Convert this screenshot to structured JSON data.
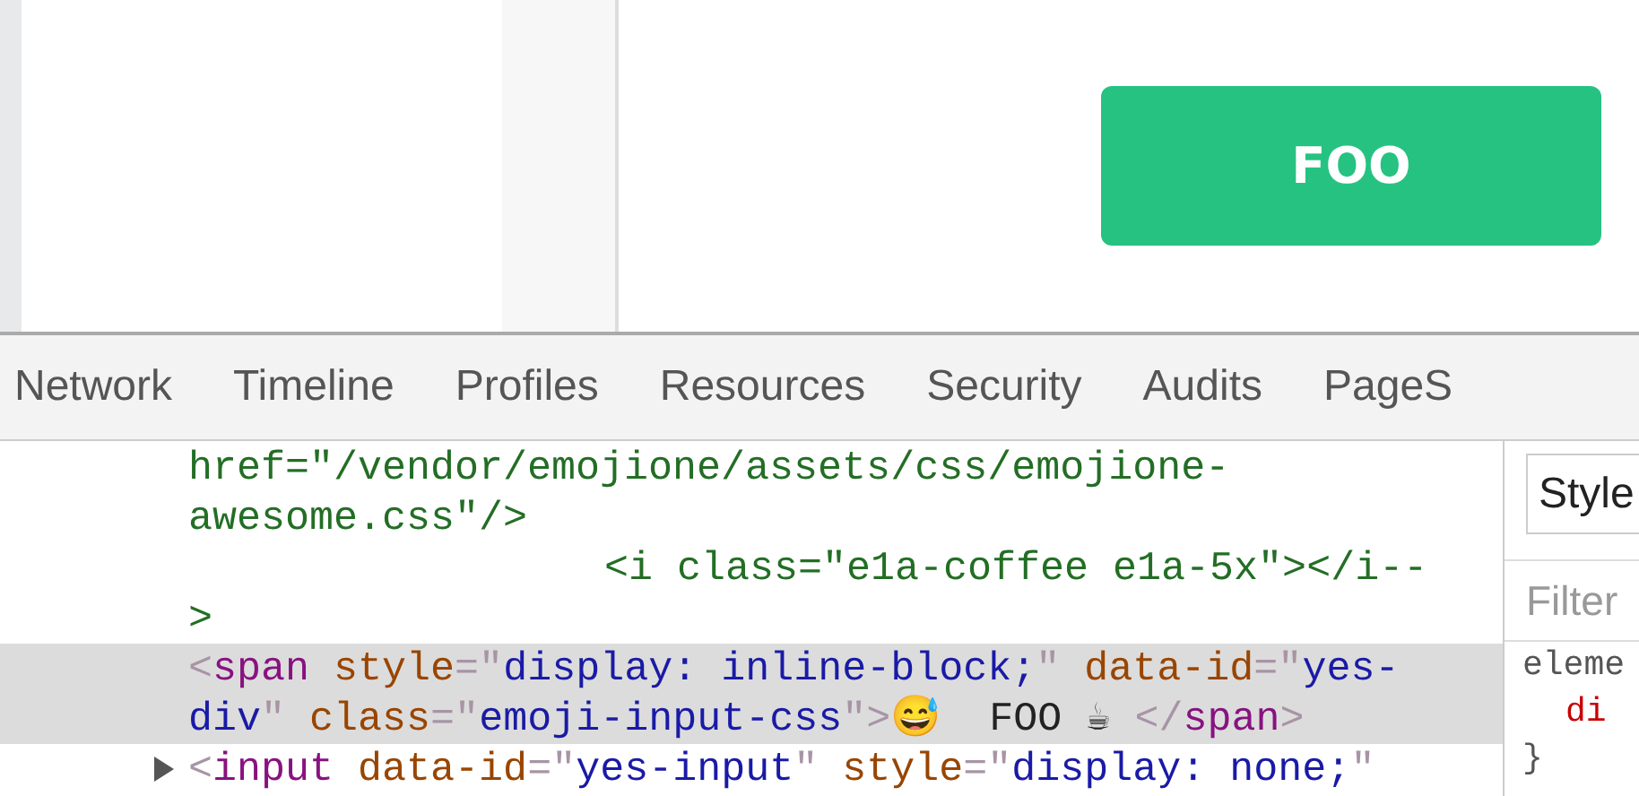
{
  "page": {
    "button": "FOO"
  },
  "devtools": {
    "tabs": [
      {
        "label": "Network",
        "selected": false
      },
      {
        "label": "Timeline",
        "selected": false
      },
      {
        "label": "Profiles",
        "selected": false
      },
      {
        "label": "Resources",
        "selected": false
      },
      {
        "label": "Security",
        "selected": false
      },
      {
        "label": "Audits",
        "selected": false
      },
      {
        "label": "PageS",
        "selected": false
      }
    ],
    "code_lines": [
      {
        "kind": "line",
        "selected": false,
        "tokens": [
          {
            "t": "href=\"/vendor/emojione/assets/css/emojione-",
            "kind": "comment"
          }
        ]
      },
      {
        "kind": "line",
        "selected": false,
        "tokens": [
          {
            "t": "awesome.css\"/>",
            "kind": "comment"
          }
        ]
      },
      {
        "kind": "inner",
        "selected": false,
        "tokens": [
          {
            "t": "<i class=\"e1a-coffee e1a-5x\"></i--",
            "kind": "comment"
          }
        ]
      },
      {
        "kind": "line",
        "selected": false,
        "tokens": [
          {
            "t": ">",
            "kind": "comment"
          }
        ]
      },
      {
        "kind": "line",
        "selected": true,
        "tokens": [
          {
            "t": "<",
            "kind": "punct"
          },
          {
            "t": "span",
            "kind": "tag"
          },
          {
            "t": " style",
            "kind": "attr"
          },
          {
            "t": "=\"",
            "kind": "punct"
          },
          {
            "t": "display: inline-block;",
            "kind": "value"
          },
          {
            "t": "\"",
            "kind": "punct"
          },
          {
            "t": " data-id",
            "kind": "attr"
          },
          {
            "t": "=\"",
            "kind": "punct"
          },
          {
            "t": "yes-",
            "kind": "value"
          }
        ]
      },
      {
        "kind": "line",
        "selected": true,
        "tokens": [
          {
            "t": "div",
            "kind": "value"
          },
          {
            "t": "\"",
            "kind": "punct"
          },
          {
            "t": " class",
            "kind": "attr"
          },
          {
            "t": "=\"",
            "kind": "punct"
          },
          {
            "t": "emoji-input-css",
            "kind": "value"
          },
          {
            "t": "\">",
            "kind": "punct"
          },
          {
            "t": "😅  FOO ☕ ",
            "kind": "text"
          },
          {
            "t": "</",
            "kind": "punct"
          },
          {
            "t": "span",
            "kind": "tag"
          },
          {
            "t": ">",
            "kind": "punct"
          }
        ]
      },
      {
        "kind": "line",
        "selected": false,
        "expanded": false,
        "tokens": [
          {
            "t": "<",
            "kind": "punct"
          },
          {
            "t": "input",
            "kind": "tag"
          },
          {
            "t": " data-id",
            "kind": "attr"
          },
          {
            "t": "=\"",
            "kind": "punct"
          },
          {
            "t": "yes-input",
            "kind": "value"
          },
          {
            "t": "\"",
            "kind": "punct"
          },
          {
            "t": " style",
            "kind": "attr"
          },
          {
            "t": "=\"",
            "kind": "punct"
          },
          {
            "t": "display: none;",
            "kind": "value"
          },
          {
            "t": "\"",
            "kind": "punct"
          }
        ]
      }
    ],
    "sidebar": {
      "tab": "Style",
      "filter_placeholder": "Filter",
      "rule_selector": "eleme",
      "rule_property": "di",
      "rule_close": "}"
    }
  }
}
